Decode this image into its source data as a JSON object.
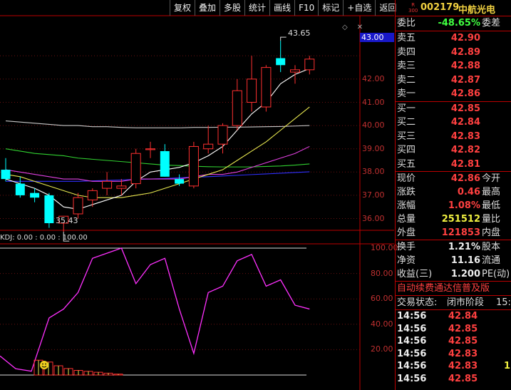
{
  "toolbar": {
    "buttons": [
      "复权",
      "叠加",
      "多股",
      "统计",
      "画线",
      "F10",
      "标记",
      "+自选",
      "返回"
    ]
  },
  "chart": {
    "current_price_tag": "43.00",
    "y_labels": [
      "43.00",
      "42.00",
      "41.00",
      "40.00",
      "39.00",
      "38.00",
      "37.00",
      "36.00"
    ],
    "high_annotation": "43.65",
    "low_annotation": "35.43",
    "indicator_label": "KDJ: 0.00 : 0.00 : 100.00",
    "indicator_y_labels": [
      "100.00",
      "80.00",
      "60.00",
      "40.00",
      "20.00"
    ],
    "colors": {
      "up": "#ff3030",
      "down": "#00ffff",
      "ma5": "#ffffff",
      "ma10": "#e8e850",
      "ma20": "#e040e0",
      "ma60": "#30d030",
      "ma120": "#3030ff",
      "ma250": "#c8c8c8",
      "kdj": "#ff30ff"
    }
  },
  "chart_data": {
    "type": "candlestick",
    "bars": [
      {
        "o": 38.1,
        "h": 38.6,
        "l": 37.6,
        "c": 37.7
      },
      {
        "o": 37.5,
        "h": 37.8,
        "l": 36.9,
        "c": 37.0
      },
      {
        "o": 37.1,
        "h": 37.3,
        "l": 36.7,
        "c": 36.9
      },
      {
        "o": 37.0,
        "h": 37.1,
        "l": 35.6,
        "c": 35.8
      },
      {
        "o": 35.8,
        "h": 36.1,
        "l": 35.43,
        "c": 36.1
      },
      {
        "o": 36.2,
        "h": 37.1,
        "l": 36.0,
        "c": 36.9
      },
      {
        "o": 36.8,
        "h": 37.3,
        "l": 36.5,
        "c": 37.2
      },
      {
        "o": 37.3,
        "h": 38.0,
        "l": 37.0,
        "c": 37.6
      },
      {
        "o": 37.3,
        "h": 37.7,
        "l": 37.0,
        "c": 37.4
      },
      {
        "o": 37.5,
        "h": 39.0,
        "l": 37.3,
        "c": 38.8
      },
      {
        "o": 39.0,
        "h": 39.3,
        "l": 38.6,
        "c": 39.0
      },
      {
        "o": 38.9,
        "h": 39.2,
        "l": 37.8,
        "c": 37.8
      },
      {
        "o": 37.7,
        "h": 37.9,
        "l": 37.4,
        "c": 37.5
      },
      {
        "o": 37.4,
        "h": 39.3,
        "l": 37.3,
        "c": 39.1
      },
      {
        "o": 39.0,
        "h": 40.0,
        "l": 38.8,
        "c": 39.2
      },
      {
        "o": 39.2,
        "h": 40.1,
        "l": 38.8,
        "c": 40.0
      },
      {
        "o": 40.0,
        "h": 42.0,
        "l": 39.8,
        "c": 41.5
      },
      {
        "o": 41.0,
        "h": 43.0,
        "l": 40.6,
        "c": 42.0
      },
      {
        "o": 40.8,
        "h": 42.6,
        "l": 40.6,
        "c": 42.5
      },
      {
        "o": 42.9,
        "h": 43.65,
        "l": 42.3,
        "c": 42.6
      },
      {
        "o": 42.3,
        "h": 42.6,
        "l": 41.8,
        "c": 42.4
      },
      {
        "o": 42.4,
        "h": 43.0,
        "l": 42.2,
        "c": 42.86
      }
    ],
    "ma5": [
      37.7,
      37.5,
      37.3,
      37.0,
      36.5,
      36.4,
      36.6,
      36.8,
      37.0,
      37.6,
      38.0,
      38.1,
      38.2,
      38.4,
      38.7,
      39.1,
      39.8,
      40.5,
      41.0,
      41.8,
      42.2,
      42.45
    ],
    "ma10": [
      37.9,
      37.8,
      37.6,
      37.4,
      37.2,
      37.0,
      36.9,
      36.9,
      36.9,
      37.0,
      37.1,
      37.3,
      37.5,
      37.7,
      37.9,
      38.1,
      38.5,
      38.9,
      39.3,
      39.8,
      40.3,
      40.8
    ],
    "ma20": [
      38.1,
      38.0,
      37.9,
      37.8,
      37.7,
      37.7,
      37.6,
      37.6,
      37.6,
      37.7,
      37.7,
      37.7,
      37.7,
      37.8,
      37.9,
      37.9,
      38.0,
      38.2,
      38.4,
      38.6,
      38.8,
      39.1
    ],
    "ma60": [
      39.0,
      38.9,
      38.8,
      38.75,
      38.7,
      38.6,
      38.55,
      38.5,
      38.45,
      38.4,
      38.35,
      38.3,
      38.28,
      38.25,
      38.23,
      38.22,
      38.22,
      38.22,
      38.24,
      38.26,
      38.3,
      38.35
    ],
    "ma120": [
      37.6,
      37.6,
      37.6,
      37.6,
      37.6,
      37.6,
      37.62,
      37.64,
      37.66,
      37.68,
      37.7,
      37.72,
      37.75,
      37.78,
      37.8,
      37.83,
      37.86,
      37.89,
      37.92,
      37.95,
      37.98,
      38.01
    ],
    "ma250": [
      40.2,
      40.15,
      40.1,
      40.05,
      40.0,
      40.0,
      39.95,
      39.95,
      39.92,
      39.9,
      39.9,
      39.9,
      39.9,
      39.92,
      39.92,
      39.93,
      39.93,
      39.94,
      39.95,
      39.96,
      39.98,
      40.0
    ],
    "kdj": [
      null,
      null,
      null,
      45,
      52,
      65,
      92,
      96,
      100,
      72,
      87,
      92,
      52,
      17,
      65,
      70,
      90,
      95,
      70,
      75,
      55,
      52
    ],
    "kdj_pre": [
      {
        "x": 0,
        "v": 15
      },
      {
        "x": 22,
        "v": 5
      },
      {
        "x": 44,
        "v": 3
      }
    ],
    "kdj_vol": [
      0.8,
      0.7,
      0.5,
      0.35,
      0.25,
      0.2,
      0.15,
      0.1,
      0.05
    ]
  },
  "panel": {
    "badge_letter": "R",
    "badge_number": "300",
    "code": "002179",
    "name": "中航光电",
    "weibi": {
      "label": "委比",
      "value": "-48.65%",
      "label2": "委差"
    },
    "asks": [
      {
        "label": "卖五",
        "price": "42.90"
      },
      {
        "label": "卖四",
        "price": "42.89"
      },
      {
        "label": "卖三",
        "price": "42.88"
      },
      {
        "label": "卖二",
        "price": "42.87"
      },
      {
        "label": "卖一",
        "price": "42.86"
      }
    ],
    "bids": [
      {
        "label": "买一",
        "price": "42.85"
      },
      {
        "label": "买二",
        "price": "42.84"
      },
      {
        "label": "买三",
        "price": "42.83"
      },
      {
        "label": "买四",
        "price": "42.82"
      },
      {
        "label": "买五",
        "price": "42.81"
      }
    ],
    "stats": [
      {
        "label": "现价",
        "value": "42.86",
        "label2": "今开",
        "color": "red"
      },
      {
        "label": "涨跌",
        "value": "0.46",
        "label2": "最高",
        "color": "red"
      },
      {
        "label": "涨幅",
        "value": "1.08%",
        "label2": "最低",
        "color": "red"
      },
      {
        "label": "总量",
        "value": "251512",
        "label2": "量比",
        "color": "yellow"
      },
      {
        "label": "外盘",
        "value": "121853",
        "label2": "内盘",
        "color": "red"
      }
    ],
    "stats2": [
      {
        "label": "换手",
        "value": "1.21%",
        "label2": "股本",
        "color": "white"
      },
      {
        "label": "净资",
        "value": "11.16",
        "label2": "流通",
        "color": "white"
      },
      {
        "label": "收益(三)",
        "value": "1.200",
        "label2": "PE(动)",
        "color": "white"
      }
    ],
    "banner": "自动续费通达信普及版",
    "status_label": "交易状态:",
    "status_value": "闭市阶段",
    "status_time": "15:",
    "ticks": [
      {
        "time": "14:56",
        "price": "42.84",
        "vol": ""
      },
      {
        "time": "14:56",
        "price": "42.85",
        "vol": ""
      },
      {
        "time": "14:56",
        "price": "42.85",
        "vol": ""
      },
      {
        "time": "14:56",
        "price": "42.83",
        "vol": ""
      },
      {
        "time": "14:56",
        "price": "42.83",
        "vol": "1"
      },
      {
        "time": "14:56",
        "price": "42.85",
        "vol": ""
      }
    ]
  }
}
